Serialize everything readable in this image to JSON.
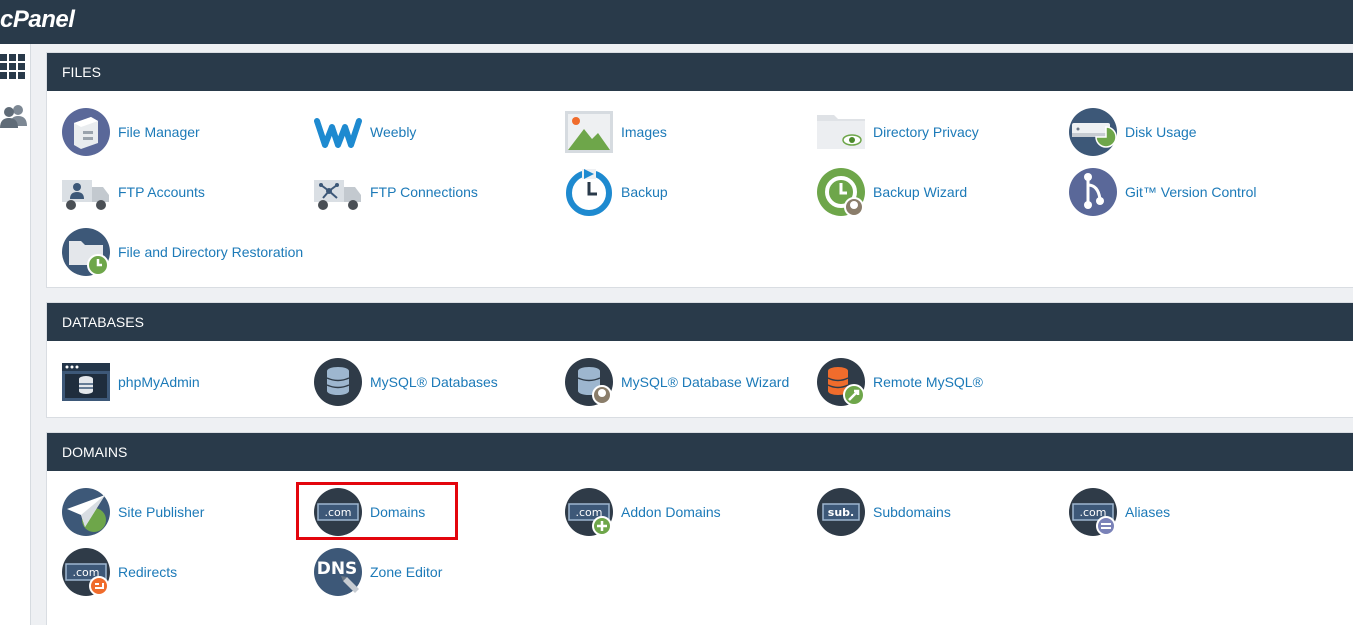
{
  "app": {
    "logo": "cPanel"
  },
  "sidebar": {
    "items": [
      {
        "icon": "grid-icon"
      },
      {
        "icon": "users-icon"
      }
    ]
  },
  "sections": {
    "files": {
      "title": "FILES",
      "items": [
        {
          "label": "File Manager",
          "icon": "file-manager-icon"
        },
        {
          "label": "Weebly",
          "icon": "weebly-icon"
        },
        {
          "label": "Images",
          "icon": "images-icon"
        },
        {
          "label": "Directory Privacy",
          "icon": "directory-privacy-icon"
        },
        {
          "label": "Disk Usage",
          "icon": "disk-usage-icon"
        },
        {
          "label": "FTP Accounts",
          "icon": "ftp-accounts-icon"
        },
        {
          "label": "FTP Connections",
          "icon": "ftp-connections-icon"
        },
        {
          "label": "Backup",
          "icon": "backup-icon"
        },
        {
          "label": "Backup Wizard",
          "icon": "backup-wizard-icon"
        },
        {
          "label": "Git™ Version Control",
          "icon": "git-icon"
        },
        {
          "label": "File and Directory Restoration",
          "icon": "file-restoration-icon"
        }
      ]
    },
    "databases": {
      "title": "DATABASES",
      "items": [
        {
          "label": "phpMyAdmin",
          "icon": "phpmyadmin-icon"
        },
        {
          "label": "MySQL® Databases",
          "icon": "mysql-databases-icon"
        },
        {
          "label": "MySQL® Database Wizard",
          "icon": "mysql-wizard-icon"
        },
        {
          "label": "Remote MySQL®",
          "icon": "remote-mysql-icon"
        }
      ]
    },
    "domains": {
      "title": "DOMAINS",
      "items": [
        {
          "label": "Site Publisher",
          "icon": "site-publisher-icon"
        },
        {
          "label": "Domains",
          "icon": "domains-icon",
          "badge": ".com"
        },
        {
          "label": "Addon Domains",
          "icon": "addon-domains-icon",
          "badge": ".com"
        },
        {
          "label": "Subdomains",
          "icon": "subdomains-icon",
          "badge": "sub."
        },
        {
          "label": "Aliases",
          "icon": "aliases-icon",
          "badge": ".com"
        },
        {
          "label": "Redirects",
          "icon": "redirects-icon",
          "badge": ".com"
        },
        {
          "label": "Zone Editor",
          "icon": "zone-editor-icon",
          "badge": "DNS"
        }
      ]
    }
  },
  "colors": {
    "header": "#293a4a",
    "link": "#1c7ab8",
    "highlight": "#e3050d"
  }
}
